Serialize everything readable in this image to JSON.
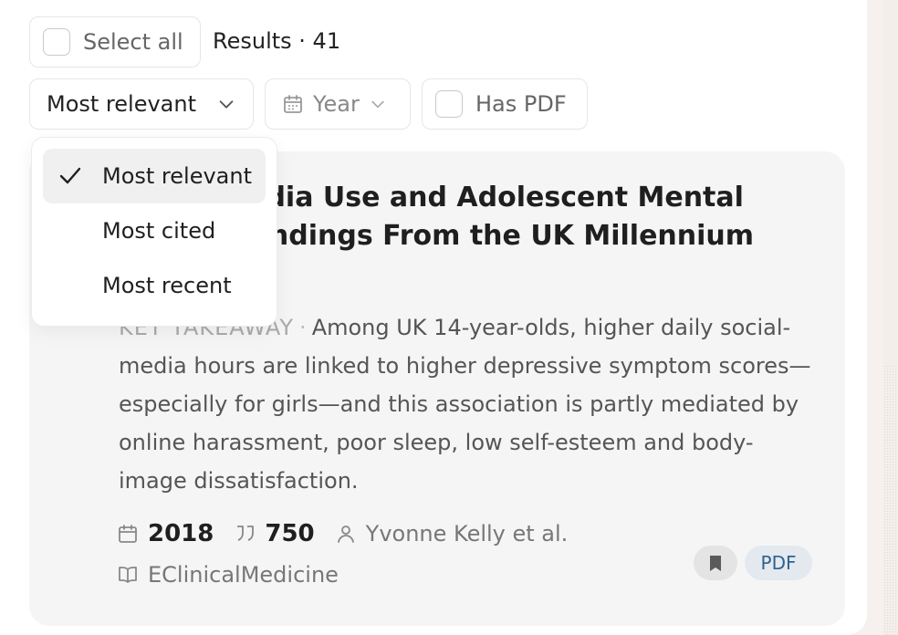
{
  "toolbar": {
    "select_all_label": "Select all",
    "results_label": "Results · 41"
  },
  "filters": {
    "sort_selected": "Most relevant",
    "year_label": "Year",
    "has_pdf_label": "Has PDF"
  },
  "sort_menu": {
    "options": [
      "Most relevant",
      "Most cited",
      "Most recent"
    ],
    "selected_index": 0
  },
  "card": {
    "title_line1": "Social Media Use and Adolescent Mental",
    "title_line2": "Health: Findings From the UK Millennium Cohort",
    "takeaway_label": "KEY TAKEAWAY",
    "takeaway_text": "Among UK 14-year-olds, higher daily social-media hours are linked to higher depressive symptom scores—especially for girls—and this association is partly mediated by online harassment, poor sleep, low self-esteem and body-image dissatisfaction.",
    "year": "2018",
    "citations": "750",
    "authors": "Yvonne Kelly et al.",
    "journal": "EClinicalMedicine",
    "pdf_label": "PDF"
  },
  "icons": {
    "year": "calendar-icon",
    "citations": "quote-icon",
    "authors": "person-icon",
    "journal": "book-icon",
    "bookmark": "bookmark-icon",
    "check": "check-icon",
    "chevron": "chevron-down-icon"
  }
}
